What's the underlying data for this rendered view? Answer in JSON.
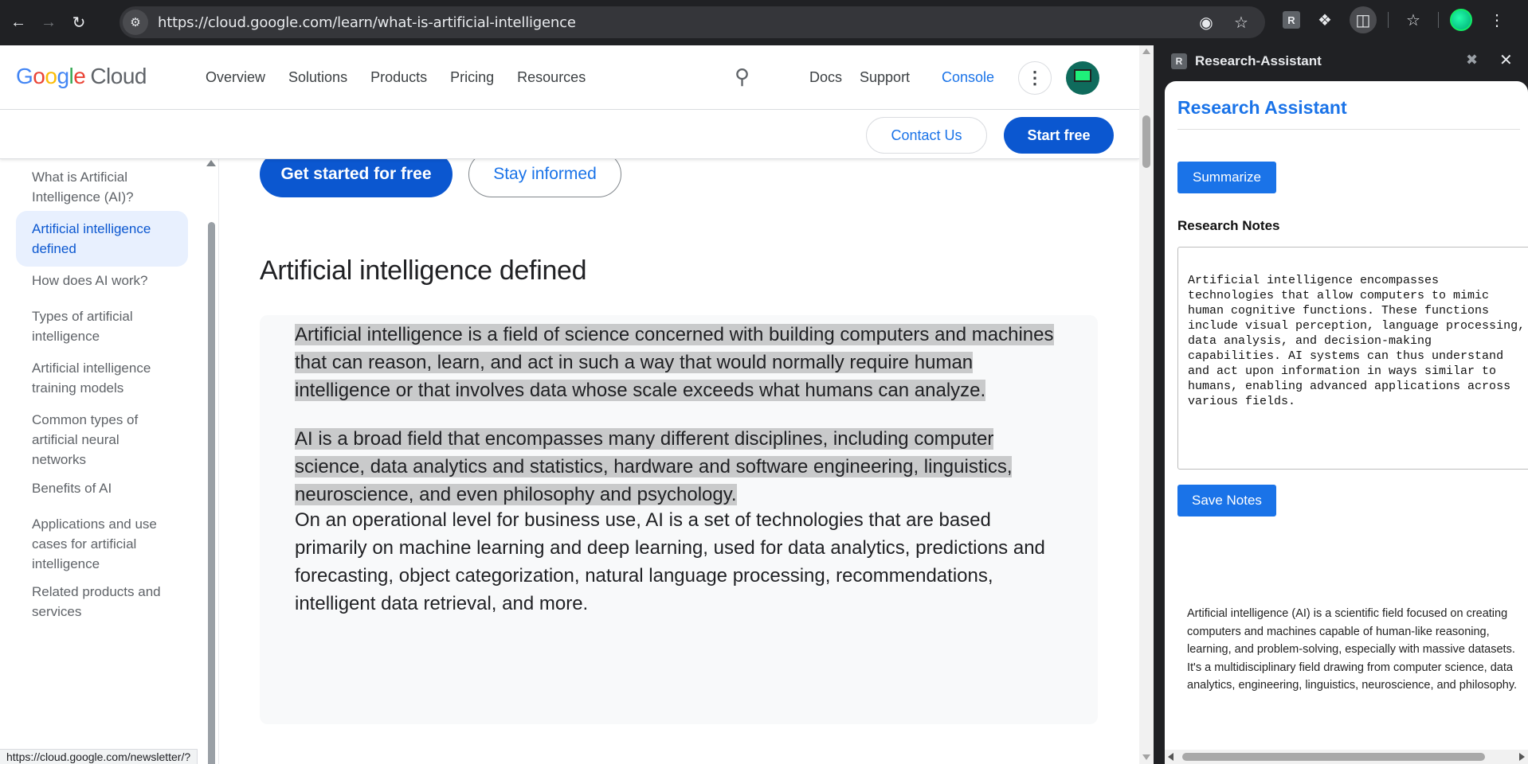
{
  "browser": {
    "url": "https://cloud.google.com/learn/what-is-artificial-intelligence",
    "status_url": "https://cloud.google.com/newsletter/?",
    "icons": [
      "back-icon",
      "forward-icon",
      "reload-icon",
      "site-info-icon",
      "eye-off-icon",
      "bookmark-star-icon",
      "extension-r-icon",
      "puzzle-icon",
      "side-panel-icon",
      "bookmarks-icon",
      "profile-icon",
      "menu-icon"
    ],
    "extension_letter": "R"
  },
  "site": {
    "logo_google": [
      "G",
      "o",
      "o",
      "g",
      "l",
      "e"
    ],
    "logo_cloud": "Cloud",
    "nav": [
      "Overview",
      "Solutions",
      "Products",
      "Pricing",
      "Resources"
    ],
    "docs": "Docs",
    "support": "Support",
    "console": "Console",
    "contact_us": "Contact Us",
    "start_free": "Start free"
  },
  "toc": {
    "items": [
      "What is Artificial Intelligence (AI)?",
      "Artificial intelligence defined",
      "How does AI work?",
      "Types of artificial intelligence",
      "Artificial intelligence training models",
      "Common types of artificial neural networks",
      "Benefits of AI",
      "Applications and use cases for artificial intelligence",
      "Related products and services"
    ],
    "active_index": 1
  },
  "main": {
    "get_started": "Get started for free",
    "stay_informed": "Stay informed",
    "heading": "Artificial intelligence defined",
    "para1": "Artificial intelligence is a field of science concerned with building computers and machines that can reason, learn, and act in such a way that would normally require human intelligence or that involves data whose scale exceeds what humans can analyze.",
    "para2": "AI is a broad field that encompasses many different disciplines, including computer science, data analytics and statistics, hardware and software engineering, linguistics, neuroscience, and even philosophy and psychology.",
    "para3": "On an operational level for business use, AI is a set of technologies that are based primarily on machine learning and deep learning, used for data analytics, predictions and forecasting, object categorization, natural language processing, recommendations, intelligent data retrieval, and more."
  },
  "side_panel": {
    "header_title": "Research-Assistant",
    "title": "Research Assistant",
    "summarize": "Summarize",
    "notes_label": "Research Notes",
    "notes_value": "Artificial intelligence encompasses technologies that allow computers to mimic human cognitive functions. These functions include visual perception, language processing, data analysis, and decision-making capabilities. AI systems can thus understand and act upon information in ways similar to humans, enabling advanced applications across various fields.",
    "save_notes": "Save Notes",
    "summary": "Artificial intelligence (AI) is a scientific field focused on creating computers and machines capable of human-like reasoning, learning, and problem-solving, especially with massive datasets. It's a multidisciplinary field drawing from computer science, data analytics, engineering, linguistics, neuroscience, and philosophy."
  }
}
